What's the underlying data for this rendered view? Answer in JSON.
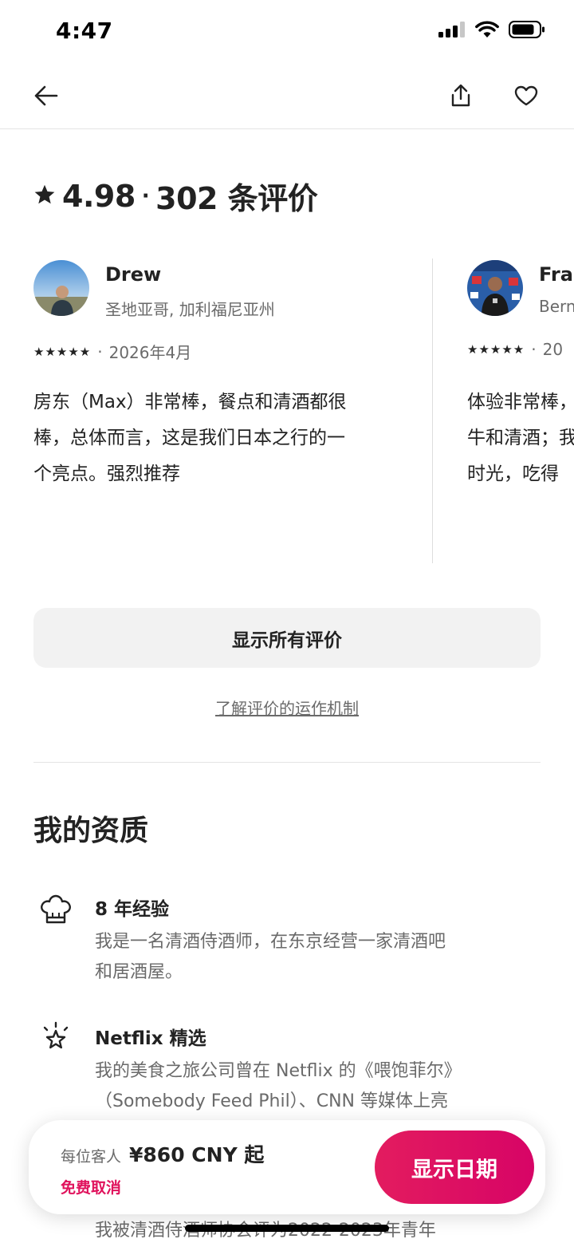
{
  "status_bar": {
    "time": "4:47"
  },
  "rating": {
    "score": "4.98",
    "separator": "·",
    "count_label": "302 条评价"
  },
  "reviews": [
    {
      "name": "Drew",
      "location": "圣地亚哥, 加利福尼亚州",
      "stars": "★★★★★",
      "date_sep": "·",
      "date": "2026年4月",
      "text": "房东（Max）非常棒，餐点和清酒都很\n棒，总体而言，这是我们日本之行的一\n个亮点。强烈推荐"
    },
    {
      "name": "Fran",
      "location": "Bern",
      "stars": "★★★★★",
      "date_sep": "·",
      "date": "20",
      "text": "体验非常棒，\n牛和清酒；我\n时光，吃得"
    }
  ],
  "show_all_label": "显示所有评价",
  "learn_link": "了解评价的运作机制",
  "qualifications": {
    "title": "我的资质",
    "items": [
      {
        "icon": "chef-hat-icon",
        "title": "8 年经验",
        "desc": "我是一名清酒侍酒师，在东京经营一家清酒吧\n和居酒屋。"
      },
      {
        "icon": "sparkle-star-icon",
        "title": "Netflix 精选",
        "desc": "我的美食之旅公司曾在 Netflix 的《喂饱菲尔》\n（Somebody Feed Phil）、CNN 等媒体上亮"
      }
    ],
    "peek_text": "我被清酒侍酒师协会评为2022-2023年青年"
  },
  "booking": {
    "price_label": "每位客人",
    "price": "¥860 CNY  起",
    "free_cancel": "免费取消",
    "cta": "显示日期"
  },
  "colors": {
    "accent": "#e31c5f",
    "text": "#222222",
    "muted": "#6a6a6a"
  }
}
